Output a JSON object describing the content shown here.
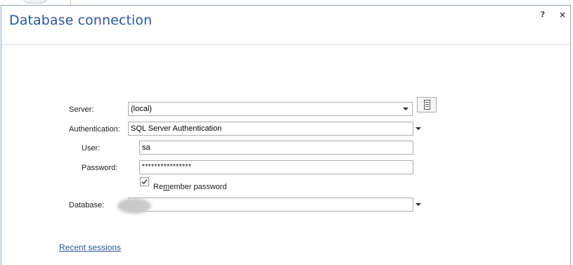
{
  "window": {
    "title": "Database connection",
    "help_label": "?",
    "close_label": "×"
  },
  "form": {
    "server": {
      "label": "Server:",
      "value": "(local)"
    },
    "authentication": {
      "label": "Authentication:",
      "value": "SQL Server Authentication"
    },
    "user": {
      "label": "User:",
      "value": "sa"
    },
    "password": {
      "label": "Password:",
      "value": "****************"
    },
    "remember": {
      "label_pre": "Re",
      "label_mnemonic": "m",
      "label_post": "ember password",
      "checked": true
    },
    "database": {
      "label": "Database:",
      "value": ""
    }
  },
  "footer": {
    "recent_sessions": "Recent sessions"
  },
  "icons": {
    "browse": "server-browse-icon",
    "check": "checkmark-icon",
    "dropdown": "chevron-down-icon"
  },
  "colors": {
    "title": "#2b579a",
    "link": "#2b579a",
    "border": "#abadb3"
  }
}
